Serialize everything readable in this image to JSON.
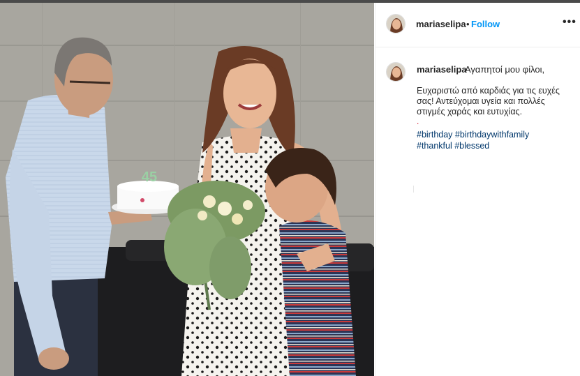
{
  "post": {
    "username": "mariaselipa",
    "separator": "•",
    "follow_label": "Follow",
    "more_label": "•••",
    "photo_icon": "instagram-photo",
    "cake_candles": "45"
  },
  "caption": {
    "username": "mariaselipa",
    "first_line": "Αγαπητοί μου φίλοι,",
    "lines": [
      "Ευχαριστώ από καρδιάς για τις ευχές",
      "σας! Αντεύχομαι υγεία και πολλές",
      "στιγμές χαράς και ευτυχίας."
    ],
    "dot": ".",
    "hashtags": [
      "#birthday",
      "#birthdaywithfamily",
      "#thankful",
      "#blessed"
    ]
  },
  "colors": {
    "link": "#0095f6",
    "hashtag": "#00376b",
    "text": "#262626",
    "accent_dot": "#d0021b"
  }
}
